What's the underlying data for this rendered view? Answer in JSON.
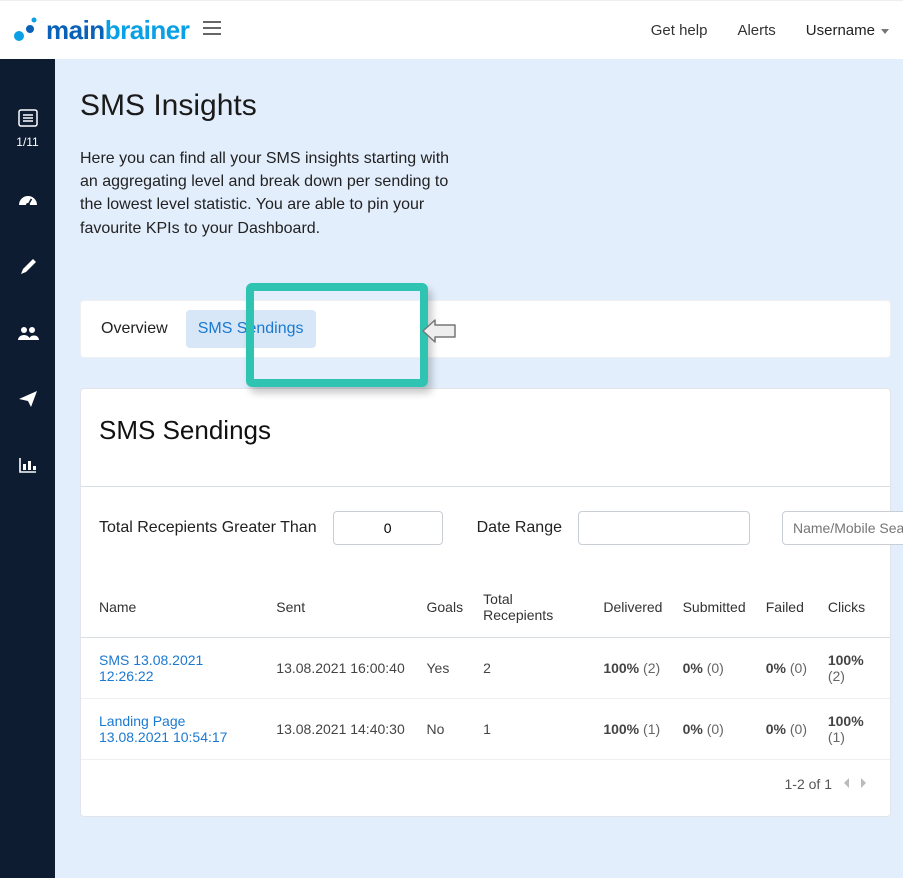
{
  "header": {
    "brand_a": "main",
    "brand_b": "brainer",
    "get_help": "Get help",
    "alerts": "Alerts",
    "username": "Username"
  },
  "sidebar": {
    "step_label": "1/11"
  },
  "page": {
    "title": "SMS Insights",
    "description": "Here you can find all your SMS insights starting with an aggregating level and break down per sending to the lowest level statistic. You are able to pin your favourite KPIs to your Dashboard."
  },
  "tabs": {
    "overview": "Overview",
    "sendings": "SMS Sendings"
  },
  "card": {
    "title": "SMS Sendings",
    "filters": {
      "recipients_label": "Total Recepients Greater Than",
      "recipients_value": "0",
      "date_label": "Date Range",
      "date_value": "",
      "search_placeholder": "Name/Mobile Search"
    },
    "columns": {
      "name": "Name",
      "sent": "Sent",
      "goals": "Goals",
      "total": "Total Recepients",
      "delivered": "Delivered",
      "submitted": "Submitted",
      "failed": "Failed",
      "clicks": "Clicks"
    },
    "rows": [
      {
        "name": "SMS 13.08.2021 12:26:22",
        "sent": "13.08.2021 16:00:40",
        "goals": "Yes",
        "total": "2",
        "delivered_pct": "100%",
        "delivered_ct": "(2)",
        "submitted_pct": "0%",
        "submitted_ct": "(0)",
        "failed_pct": "0%",
        "failed_ct": "(0)",
        "clicks_pct": "100%",
        "clicks_ct": "(2)"
      },
      {
        "name": "Landing Page 13.08.2021 10:54:17",
        "sent": "13.08.2021 14:40:30",
        "goals": "No",
        "total": "1",
        "delivered_pct": "100%",
        "delivered_ct": "(1)",
        "submitted_pct": "0%",
        "submitted_ct": "(0)",
        "failed_pct": "0%",
        "failed_ct": "(0)",
        "clicks_pct": "100%",
        "clicks_ct": "(1)"
      }
    ],
    "pager": "1-2 of 1"
  }
}
